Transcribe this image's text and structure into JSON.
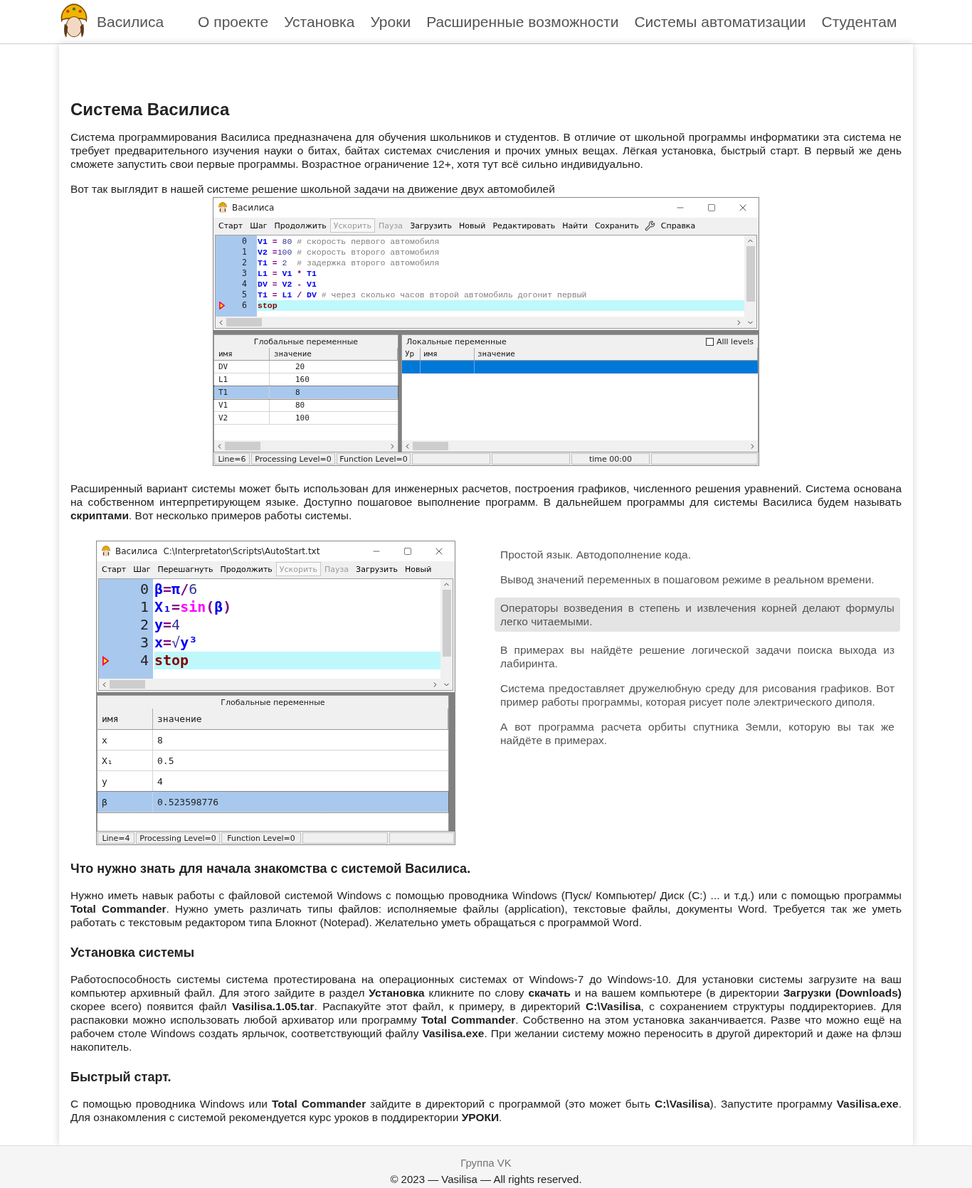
{
  "nav": {
    "logo_text": "Василиса",
    "items": [
      {
        "label": "О проекте"
      },
      {
        "label": "Установка"
      },
      {
        "label": "Уроки"
      },
      {
        "label": "Расширенные возможности"
      },
      {
        "label": "Системы автоматизации"
      },
      {
        "label": "Студентам"
      }
    ]
  },
  "title": "Система Василиса",
  "intro": "Система программирования Василиса предназначена для обучения школьников и студентов. В отличие от школьной программы информатики эта система не требует предварительного изучения науки о битах, байтах системах счисления и прочих умных вещах. Лёгкая установка, быстрый старт. В первый же день сможете запустить свои первые программы. Возрастное ограничение 12+, хотя тут всё сильно индивидуально.",
  "caption": "Вот так выглядит в нашей системе решение школьной задачи на движение двух автомобилей",
  "window1": {
    "title": "Василиса",
    "menu": [
      {
        "label": "Старт",
        "kind": "text",
        "disabled": false,
        "pressed": false
      },
      {
        "label": "Шаг",
        "kind": "text",
        "disabled": false,
        "pressed": false
      },
      {
        "label": "Продолжить",
        "kind": "text",
        "disabled": false,
        "pressed": false
      },
      {
        "label": "Ускорить",
        "kind": "text",
        "disabled": true,
        "pressed": true
      },
      {
        "label": "Пауза",
        "kind": "text",
        "disabled": true,
        "pressed": false
      },
      {
        "label": "Загрузить",
        "kind": "text",
        "disabled": false,
        "pressed": false
      },
      {
        "label": "Новый",
        "kind": "text",
        "disabled": false,
        "pressed": false
      },
      {
        "label": "Редактировать",
        "kind": "text",
        "disabled": false,
        "pressed": false
      },
      {
        "label": "Найти",
        "kind": "text",
        "disabled": false,
        "pressed": false
      },
      {
        "label": "Сохранить",
        "kind": "text",
        "disabled": false,
        "pressed": false
      },
      {
        "label": "Справка",
        "kind": "tools",
        "disabled": false,
        "pressed": false
      }
    ],
    "code": [
      {
        "n": "0",
        "current": false,
        "tokens": [
          {
            "kind": "name",
            "t": "V1 "
          },
          {
            "kind": "op",
            "t": "= "
          },
          {
            "kind": "num",
            "t": "80 "
          },
          {
            "kind": "comment",
            "t": "# скорость первого автомобиля"
          }
        ]
      },
      {
        "n": "1",
        "current": false,
        "tokens": [
          {
            "kind": "name",
            "t": "V2 "
          },
          {
            "kind": "op",
            "t": "="
          },
          {
            "kind": "num",
            "t": "100 "
          },
          {
            "kind": "comment",
            "t": "# скорость второго автомобиля"
          }
        ]
      },
      {
        "n": "2",
        "current": false,
        "tokens": [
          {
            "kind": "name",
            "t": "T1 "
          },
          {
            "kind": "op",
            "t": "= "
          },
          {
            "kind": "num",
            "t": "2  "
          },
          {
            "kind": "comment",
            "t": "# задержка второго автомобиля"
          }
        ]
      },
      {
        "n": "3",
        "current": false,
        "tokens": [
          {
            "kind": "name",
            "t": "L1 "
          },
          {
            "kind": "op",
            "t": "= "
          },
          {
            "kind": "name",
            "t": "V1 "
          },
          {
            "kind": "op",
            "t": "* "
          },
          {
            "kind": "name",
            "t": "T1"
          }
        ]
      },
      {
        "n": "4",
        "current": false,
        "tokens": [
          {
            "kind": "name",
            "t": "DV "
          },
          {
            "kind": "op",
            "t": "= "
          },
          {
            "kind": "name",
            "t": "V2 "
          },
          {
            "kind": "op",
            "t": "- "
          },
          {
            "kind": "name",
            "t": "V1"
          }
        ]
      },
      {
        "n": "5",
        "current": false,
        "tokens": [
          {
            "kind": "name",
            "t": "T1 "
          },
          {
            "kind": "op",
            "t": "= "
          },
          {
            "kind": "name",
            "t": "L1 "
          },
          {
            "kind": "op",
            "t": "/ "
          },
          {
            "kind": "name",
            "t": "DV "
          },
          {
            "kind": "comment",
            "t": "# через сколько часов второй автомобиль догонит первый"
          }
        ]
      },
      {
        "n": "6",
        "current": true,
        "tokens": [
          {
            "kind": "keyword",
            "t": "stop"
          }
        ]
      }
    ],
    "globals": {
      "title": "Глобальные переменные",
      "columns": [
        "имя",
        "значение"
      ],
      "rows": [
        {
          "name": "DV",
          "value": "20",
          "selected": false
        },
        {
          "name": "L1",
          "value": "160",
          "selected": false
        },
        {
          "name": "T1",
          "value": "8",
          "selected": true
        },
        {
          "name": "V1",
          "value": "80",
          "selected": false
        },
        {
          "name": "V2",
          "value": "100",
          "selected": false
        }
      ]
    },
    "locals": {
      "title": "Локальные переменные",
      "checkbox": {
        "label": "Alll levels",
        "checked": false
      },
      "columns": [
        "Ур",
        "имя",
        "значение"
      ],
      "rows": [
        {
          "selected": true
        }
      ]
    },
    "status_bar": [
      {
        "kind": "text",
        "text": "Line=6"
      },
      {
        "kind": "text",
        "text": "Processing Level=0"
      },
      {
        "kind": "text",
        "text": "Function Level=0"
      },
      {
        "kind": "blank"
      },
      {
        "kind": "blank"
      },
      {
        "kind": "text",
        "text": "time 00:00"
      },
      {
        "kind": "blank"
      }
    ]
  },
  "para2": "Расширенный вариант системы может быть использован для инженерных расчетов, построения графиков, численного решения уравнений. Система основана на собственном интерпретирующем языке. Доступно пошаговое выполнение программ. В дальнейшем программы для системы Василиса будем называть **скриптами**. Вот несколько примеров работы системы.",
  "window2": {
    "title": "Василиса",
    "path": "C:\\Interpretator\\Scripts\\AutoStart.txt",
    "menu": [
      {
        "label": "Старт",
        "kind": "text",
        "disabled": false,
        "pressed": false
      },
      {
        "label": "Шаг",
        "kind": "text",
        "disabled": false,
        "pressed": false
      },
      {
        "label": "Перешагнуть",
        "kind": "text",
        "disabled": false,
        "pressed": false
      },
      {
        "label": "Продолжить",
        "kind": "text",
        "disabled": false,
        "pressed": false
      },
      {
        "label": "Ускорить",
        "kind": "text",
        "disabled": true,
        "pressed": true
      },
      {
        "label": "Пауза",
        "kind": "text",
        "disabled": true,
        "pressed": false
      },
      {
        "label": "Загрузить",
        "kind": "text",
        "disabled": false,
        "pressed": false
      },
      {
        "label": "Новый",
        "kind": "text",
        "disabled": false,
        "pressed": false
      }
    ],
    "code": [
      {
        "n": "0",
        "current": false,
        "tokens": [
          {
            "kind": "name",
            "t": "β"
          },
          {
            "kind": "op",
            "t": "="
          },
          {
            "kind": "name",
            "t": "π"
          },
          {
            "kind": "op",
            "t": "/"
          },
          {
            "kind": "num",
            "t": "6"
          }
        ]
      },
      {
        "n": "1",
        "current": false,
        "tokens": [
          {
            "kind": "name",
            "t": "X₁"
          },
          {
            "kind": "op",
            "t": "="
          },
          {
            "kind": "func",
            "t": "sin"
          },
          {
            "kind": "op",
            "t": "("
          },
          {
            "kind": "name",
            "t": "β"
          },
          {
            "kind": "op",
            "t": ")"
          }
        ]
      },
      {
        "n": "2",
        "current": false,
        "tokens": [
          {
            "kind": "name",
            "t": "y"
          },
          {
            "kind": "op",
            "t": "="
          },
          {
            "kind": "num",
            "t": "4"
          }
        ]
      },
      {
        "n": "3",
        "current": false,
        "tokens": [
          {
            "kind": "name",
            "t": "x"
          },
          {
            "kind": "op",
            "t": "="
          },
          {
            "kind": "num",
            "t": "√"
          },
          {
            "kind": "name",
            "t": "y³"
          }
        ]
      },
      {
        "n": "4",
        "current": true,
        "tokens": [
          {
            "kind": "keyword",
            "t": "stop"
          }
        ]
      }
    ],
    "globals": {
      "title": "Глобальные переменные",
      "columns": [
        "имя",
        "значение"
      ],
      "rows": [
        {
          "name": "x",
          "value": "8",
          "selected": false
        },
        {
          "name": "X₁",
          "value": "0.5",
          "selected": false
        },
        {
          "name": "y",
          "value": "4",
          "selected": false
        },
        {
          "name": "β",
          "value": "0.523598776",
          "selected": true
        }
      ]
    },
    "status_bar": [
      {
        "kind": "text",
        "text": "Line=4"
      },
      {
        "kind": "text",
        "text": "Processing Level=0"
      },
      {
        "kind": "text",
        "text": "Function Level=0"
      },
      {
        "kind": "blank"
      },
      {
        "kind": "blank"
      }
    ]
  },
  "features": [
    {
      "text": "Простой язык. Автодополнение кода.",
      "selected": false
    },
    {
      "text": "Вывод значений переменных в пошаговом режиме в реальном времени.",
      "selected": false
    },
    {
      "text": "Операторы возведения в степень и извлечения корней делают формулы легко читаемыми.",
      "selected": true
    },
    {
      "text": "В примерах вы найдёте решение логической задачи поиска выхода из лабиринта.",
      "selected": false
    },
    {
      "text": "Система предоставляет дружелюбную среду для рисования графиков. Вот пример работы программы, которая рисует поле электрического диполя.",
      "selected": false
    },
    {
      "text": "А вот программа расчета орбиты спутника Земли, которую вы так же найдёте в примерах.",
      "selected": false
    }
  ],
  "sections": [
    {
      "heading": "Что нужно знать для начала знакомства с системой Василиса.",
      "text": "Нужно иметь навык работы с файловой системой Windows с помощью проводника Windows (Пуск/ Компьютер/ Диск (С:) ... и т.д.) или с помощью программы **Total Commander**. Нужно уметь различать типы файлов: исполняемые файлы (application), текстовые файлы, документы Word. Требуется так же уметь работать с текстовым редактором типа Блокнот (Notepad). Желательно уметь обращаться с программой Word."
    },
    {
      "heading": "Установка системы",
      "text": "Работоспособность системы система протестирована на операционных системах от Windows-7 до Windows-10. Для установки системы загрузите на ваш компьютер архивный файл. Для этого зайдите в раздел **Установка** кликните по слову **скачать** и на вашем компьютере (в директории **Загрузки (Downloads)** скорее всего) появится файл **Vasilisa.1.05.tar**. Распакуйте этот файл, к примеру, в директорий **C:\\Vasilisa**, с сохранением структуры поддиректориев. Для распаковки можно использовать любой архиватор или программу **Total Commander**. Собственно на этом установка заканчивается. Разве что можно ещё на рабочем столе Windows создать ярлычок, соответствующий файлу **Vasilisa.exe**. При желании систему можно переносить в другой директорий и даже на флэш накопитель."
    },
    {
      "heading": "Быстрый старт.",
      "text": "С помощью проводника Windows или **Total Commander** зайдите в директорий с программой (это может быть **C:\\Vasilisa**). Запустите программу **Vasilisa.exe**. Для ознакомления с системой рекомендуется курс уроков в поддиректории **УРОКИ**."
    }
  ],
  "footer": {
    "link": "Группа VK",
    "copyright": "© 2023 — Vasilisa — All rights reserved."
  }
}
